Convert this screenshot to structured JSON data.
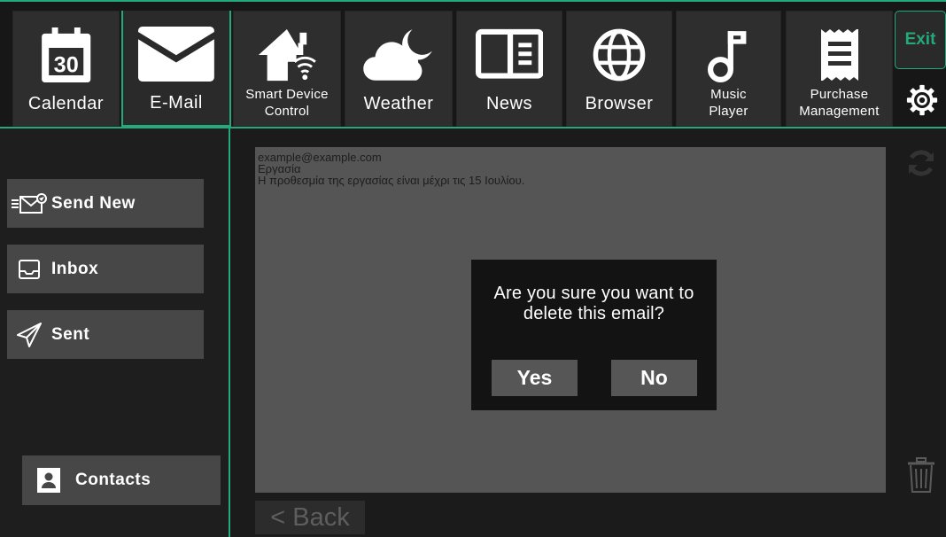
{
  "apps": [
    {
      "id": "calendar",
      "label": "Calendar",
      "icon": "calendar-icon",
      "icon_text": "30"
    },
    {
      "id": "email",
      "label": "E-Mail",
      "icon": "mail-icon",
      "active": true
    },
    {
      "id": "smart-device",
      "label": "Smart Device Control",
      "line1": "Smart Device",
      "line2": "Control",
      "icon": "smart-home-icon"
    },
    {
      "id": "weather",
      "label": "Weather",
      "icon": "weather-icon"
    },
    {
      "id": "news",
      "label": "News",
      "icon": "news-icon"
    },
    {
      "id": "browser",
      "label": "Browser",
      "icon": "globe-icon"
    },
    {
      "id": "music",
      "label": "Music Player",
      "line1": "Music",
      "line2": "Player",
      "icon": "music-note-icon"
    },
    {
      "id": "purchase",
      "label": "Purchase Management",
      "line1": "Purchase",
      "line2": "Management",
      "icon": "receipt-icon"
    }
  ],
  "header": {
    "exit_label": "Exit",
    "settings_icon": "gear-icon"
  },
  "sidebar": {
    "send_new": "Send New",
    "inbox": "Inbox",
    "sent": "Sent",
    "contacts": "Contacts"
  },
  "email": {
    "from": "example@example.com",
    "subject": "Εργασία",
    "body": "Η προθεσμία της εργασίας είναι μέχρι τις 15 Ιουλίου."
  },
  "dialog": {
    "line1": "Are you sure you want to",
    "line2": "delete this email?",
    "yes": "Yes",
    "no": "No"
  },
  "footer": {
    "back": "< Back"
  },
  "colors": {
    "accent": "#23a97a",
    "tile": "#2e2e2e",
    "button": "#474747",
    "content": "#555555",
    "dialog": "#131313"
  }
}
